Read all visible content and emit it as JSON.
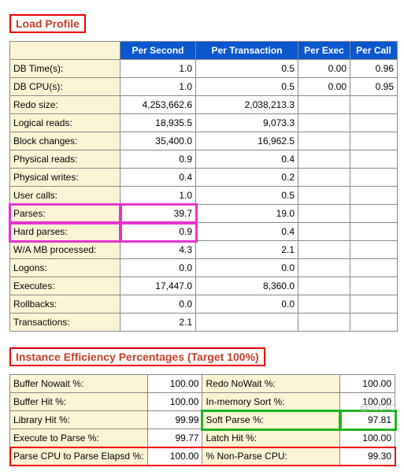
{
  "loadProfile": {
    "title": "Load Profile",
    "headers": [
      "",
      "Per Second",
      "Per Transaction",
      "Per Exec",
      "Per Call"
    ],
    "rows": [
      {
        "label": "DB Time(s):",
        "perSec": "1.0",
        "perTx": "0.5",
        "perExec": "0.00",
        "perCall": "0.96"
      },
      {
        "label": "DB CPU(s):",
        "perSec": "1.0",
        "perTx": "0.5",
        "perExec": "0.00",
        "perCall": "0.95"
      },
      {
        "label": "Redo size:",
        "perSec": "4,253,662.6",
        "perTx": "2,038,213.3",
        "perExec": "",
        "perCall": ""
      },
      {
        "label": "Logical reads:",
        "perSec": "18,935.5",
        "perTx": "9,073.3",
        "perExec": "",
        "perCall": ""
      },
      {
        "label": "Block changes:",
        "perSec": "35,400.0",
        "perTx": "16,962.5",
        "perExec": "",
        "perCall": ""
      },
      {
        "label": "Physical reads:",
        "perSec": "0.9",
        "perTx": "0.4",
        "perExec": "",
        "perCall": ""
      },
      {
        "label": "Physical writes:",
        "perSec": "0.4",
        "perTx": "0.2",
        "perExec": "",
        "perCall": ""
      },
      {
        "label": "User calls:",
        "perSec": "1.0",
        "perTx": "0.5",
        "perExec": "",
        "perCall": ""
      },
      {
        "label": "Parses:",
        "perSec": "39.7",
        "perTx": "19.0",
        "perExec": "",
        "perCall": "",
        "hl": "pink"
      },
      {
        "label": "Hard parses:",
        "perSec": "0.9",
        "perTx": "0.4",
        "perExec": "",
        "perCall": "",
        "hl": "pink"
      },
      {
        "label": "W/A MB processed:",
        "perSec": "4.3",
        "perTx": "2.1",
        "perExec": "",
        "perCall": ""
      },
      {
        "label": "Logons:",
        "perSec": "0.0",
        "perTx": "0.0",
        "perExec": "",
        "perCall": ""
      },
      {
        "label": "Executes:",
        "perSec": "17,447.0",
        "perTx": "8,360.0",
        "perExec": "",
        "perCall": ""
      },
      {
        "label": "Rollbacks:",
        "perSec": "0.0",
        "perTx": "0.0",
        "perExec": "",
        "perCall": ""
      },
      {
        "label": "Transactions:",
        "perSec": "2.1",
        "perTx": "",
        "perExec": "",
        "perCall": ""
      }
    ]
  },
  "efficiency": {
    "title": "Instance Efficiency Percentages (Target 100%)",
    "rows": [
      {
        "l1": "Buffer Nowait %:",
        "v1": "100.00",
        "l2": "Redo NoWait %:",
        "v2": "100.00"
      },
      {
        "l1": "Buffer Hit %:",
        "v1": "100.00",
        "l2": "In-memory Sort %:",
        "v2": "100.00"
      },
      {
        "l1": "Library Hit %:",
        "v1": "99.99",
        "l2": "Soft Parse %:",
        "v2": "97.81",
        "hlR": "green"
      },
      {
        "l1": "Execute to Parse %:",
        "v1": "99.77",
        "l2": "Latch Hit %:",
        "v2": "100.00"
      },
      {
        "l1": "Parse CPU to Parse Elapsd %:",
        "v1": "100.00",
        "l2": "% Non-Parse CPU:",
        "v2": "99.30",
        "hlRow": "red"
      }
    ]
  },
  "watermark": "@51CTO"
}
